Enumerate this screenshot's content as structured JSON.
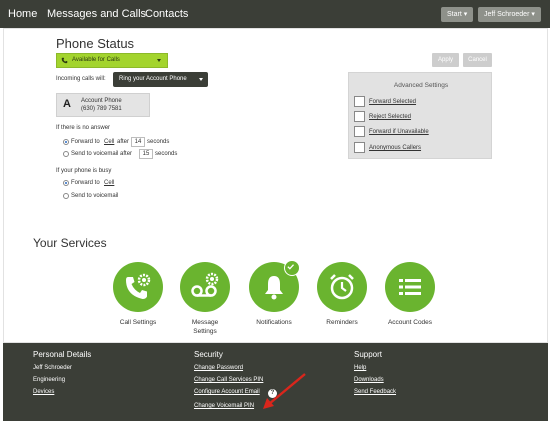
{
  "nav": {
    "home": "Home",
    "messages_calls": "Messages and Calls",
    "contacts": "Contacts",
    "start": "Start ▾",
    "user": "Jeff Schroeder ▾"
  },
  "status": {
    "title": "Phone Status",
    "availability": "Available for Calls",
    "incoming_label": "Incoming calls will:",
    "incoming_value": "Ring your Account Phone",
    "apply": "Apply",
    "cancel": "Cancel",
    "account": {
      "letter": "A",
      "name": "Account Phone",
      "number": "(630) 789 7581"
    },
    "no_answer": {
      "heading": "If there is no answer",
      "forward_to": "Forward to",
      "cell": "Cell",
      "after": "after",
      "forward_seconds": "14",
      "seconds": "seconds",
      "send_voicemail_after": "Send to voicemail after",
      "voicemail_seconds": "15",
      "seconds2": "seconds"
    },
    "busy": {
      "heading": "If your phone is busy",
      "forward_to": "Forward to",
      "cell": "Cell",
      "send_voicemail": "Send to voicemail"
    }
  },
  "advanced": {
    "title": "Advanced Settings",
    "items": [
      "Forward Selected",
      "Reject Selected",
      "Forward if Unavailable",
      "Anonymous Callers"
    ]
  },
  "services": {
    "title": "Your Services",
    "items": [
      "Call Settings",
      "Message Settings",
      "Notifications",
      "Reminders",
      "Account Codes"
    ]
  },
  "footer": {
    "personal": {
      "heading": "Personal Details",
      "name": "Jeff Schroeder",
      "dept": "Engineering",
      "devices": "Devices"
    },
    "security": {
      "heading": "Security",
      "links": [
        "Change Password",
        "Change Call Services PIN",
        "Configure Account Email",
        "Change Voicemail PIN"
      ],
      "help": "?"
    },
    "support": {
      "heading": "Support",
      "links": [
        "Help",
        "Downloads",
        "Send Feedback"
      ]
    }
  },
  "colors": {
    "nav_bg": "#3b3e37",
    "accent_green": "#6ab42f",
    "availability_green": "#a3d42e",
    "arrow_red": "#d9261c"
  }
}
